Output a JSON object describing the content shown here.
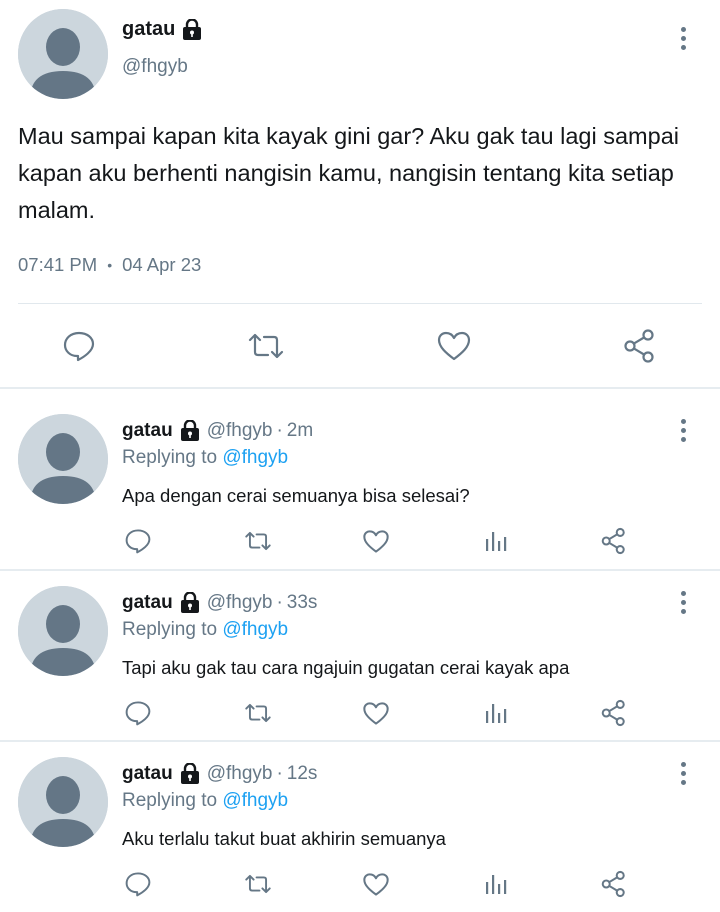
{
  "main": {
    "name": "gatau",
    "handle": "@fhgyb",
    "text": "Mau sampai kapan kita kayak gini gar? Aku gak tau lagi sampai kapan aku berhenti nangisin kamu, nangisin tentang kita setiap malam.",
    "time": "07:41 PM",
    "separator": "•",
    "date": "04 Apr 23"
  },
  "replies": [
    {
      "name": "gatau",
      "handle": "@fhgyb",
      "age": "2m",
      "replying_prefix": "Replying to",
      "replying_to": "@fhgyb",
      "text": "Apa dengan cerai semuanya bisa selesai?"
    },
    {
      "name": "gatau",
      "handle": "@fhgyb",
      "age": "33s",
      "replying_prefix": "Replying to",
      "replying_to": "@fhgyb",
      "text": "Tapi aku gak tau cara ngajuin gugatan cerai kayak apa"
    },
    {
      "name": "gatau",
      "handle": "@fhgyb",
      "age": "12s",
      "replying_prefix": "Replying to",
      "replying_to": "@fhgyb",
      "text": "Aku terlalu takut buat akhirin semuanya"
    }
  ],
  "icons": {
    "reply": "comment-icon",
    "retweet": "retweet-icon",
    "like": "heart-icon",
    "analytics": "analytics-icon",
    "share": "share-icon",
    "more": "more-vertical-icon",
    "lock": "lock-icon"
  },
  "colors": {
    "text": "#14171a",
    "secondary": "#657786",
    "link": "#1da1f2",
    "avatar_bg": "#ccd6dd",
    "avatar_fg": "#647686"
  }
}
